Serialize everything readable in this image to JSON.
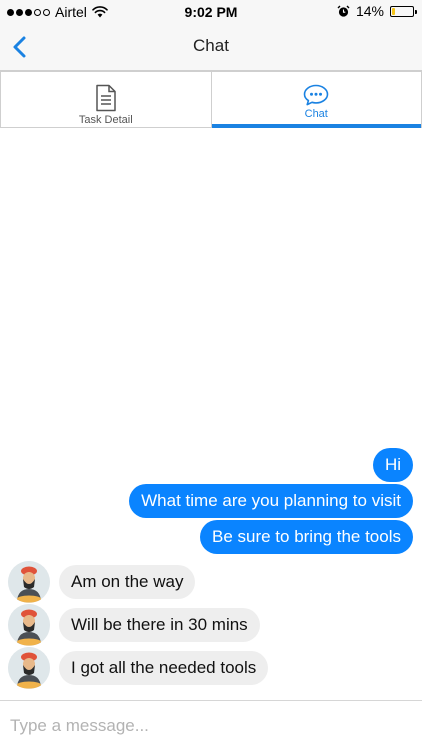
{
  "status_bar": {
    "carrier": "Airtel",
    "time": "9:02 PM",
    "battery_percent": "14%",
    "battery_level": 0.14,
    "signal_bars_filled": 3,
    "signal_bars_total": 5,
    "icons": [
      "wifi-icon",
      "alarm-icon",
      "battery-icon"
    ]
  },
  "nav": {
    "title": "Chat",
    "back_icon": "chevron-left-icon"
  },
  "tabs": [
    {
      "label": "Task Detail",
      "icon": "document-icon",
      "active": false
    },
    {
      "label": "Chat",
      "icon": "chat-bubble-icon",
      "active": true
    }
  ],
  "messages": {
    "outgoing": [
      {
        "text": "Hi"
      },
      {
        "text": "What time are you planning to visit"
      },
      {
        "text": "Be sure to bring the tools"
      }
    ],
    "incoming": [
      {
        "text": "Am on the way",
        "avatar": "avatar"
      },
      {
        "text": "Will be there in 30 mins",
        "avatar": "avatar"
      },
      {
        "text": "I got all the needed tools",
        "avatar": "avatar"
      }
    ]
  },
  "composer": {
    "placeholder": "Type a message...",
    "value": ""
  },
  "colors": {
    "accent": "#1a82e2",
    "outgoing_bubble": "#0a84ff",
    "incoming_bubble": "#eeeeee",
    "bar_background": "#f7f7f7",
    "battery_fill": "#f5c518"
  }
}
